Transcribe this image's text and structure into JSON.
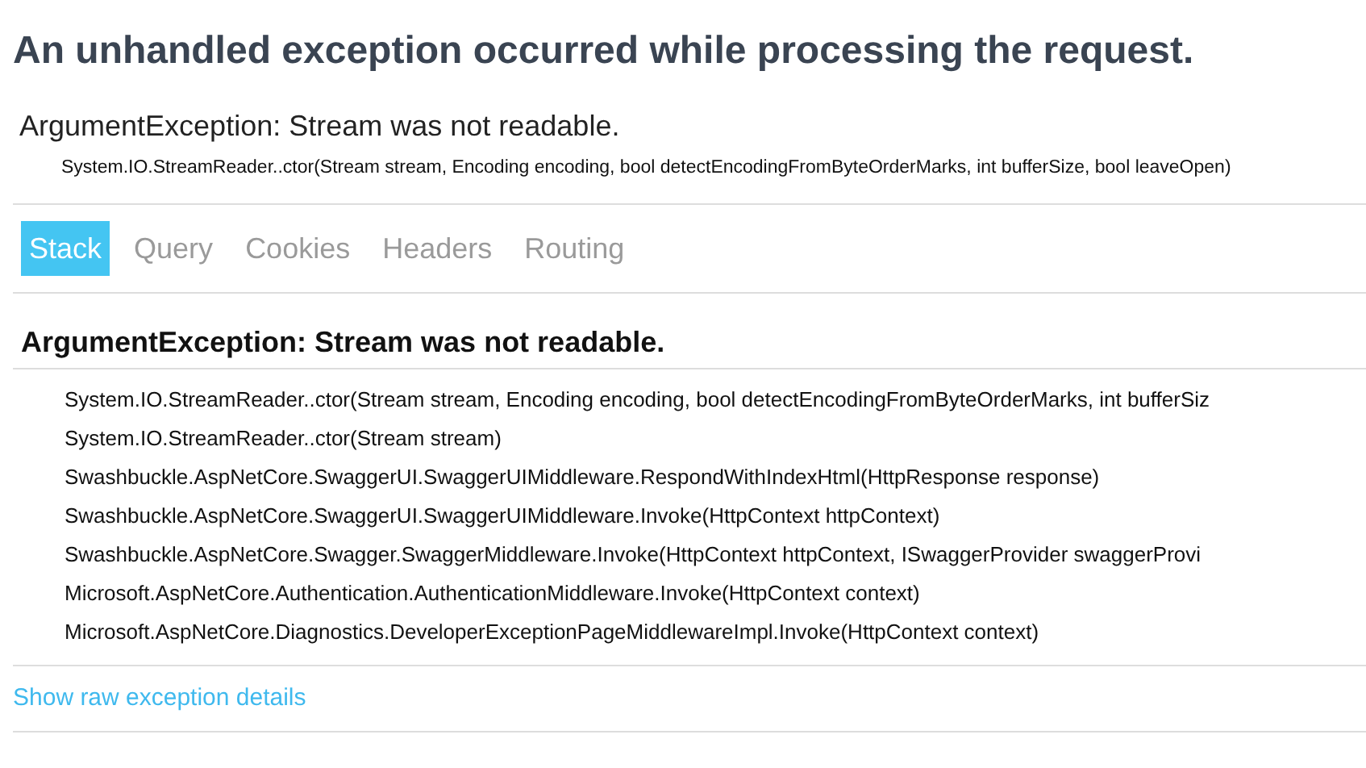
{
  "title": "An unhandled exception occurred while processing the request.",
  "summary": {
    "message": "ArgumentException: Stream was not readable.",
    "location": "System.IO.StreamReader..ctor(Stream stream, Encoding encoding, bool detectEncodingFromByteOrderMarks, int bufferSize, bool leaveOpen)"
  },
  "tabs": [
    {
      "label": "Stack",
      "selected": true
    },
    {
      "label": "Query",
      "selected": false
    },
    {
      "label": "Cookies",
      "selected": false
    },
    {
      "label": "Headers",
      "selected": false
    },
    {
      "label": "Routing",
      "selected": false
    }
  ],
  "stack": {
    "heading": "ArgumentException: Stream was not readable.",
    "frames": [
      "System.IO.StreamReader..ctor(Stream stream, Encoding encoding, bool detectEncodingFromByteOrderMarks, int bufferSiz",
      "System.IO.StreamReader..ctor(Stream stream)",
      "Swashbuckle.AspNetCore.SwaggerUI.SwaggerUIMiddleware.RespondWithIndexHtml(HttpResponse response)",
      "Swashbuckle.AspNetCore.SwaggerUI.SwaggerUIMiddleware.Invoke(HttpContext httpContext)",
      "Swashbuckle.AspNetCore.Swagger.SwaggerMiddleware.Invoke(HttpContext httpContext, ISwaggerProvider swaggerProvi",
      "Microsoft.AspNetCore.Authentication.AuthenticationMiddleware.Invoke(HttpContext context)",
      "Microsoft.AspNetCore.Diagnostics.DeveloperExceptionPageMiddlewareImpl.Invoke(HttpContext context)"
    ]
  },
  "raw_link": "Show raw exception details"
}
